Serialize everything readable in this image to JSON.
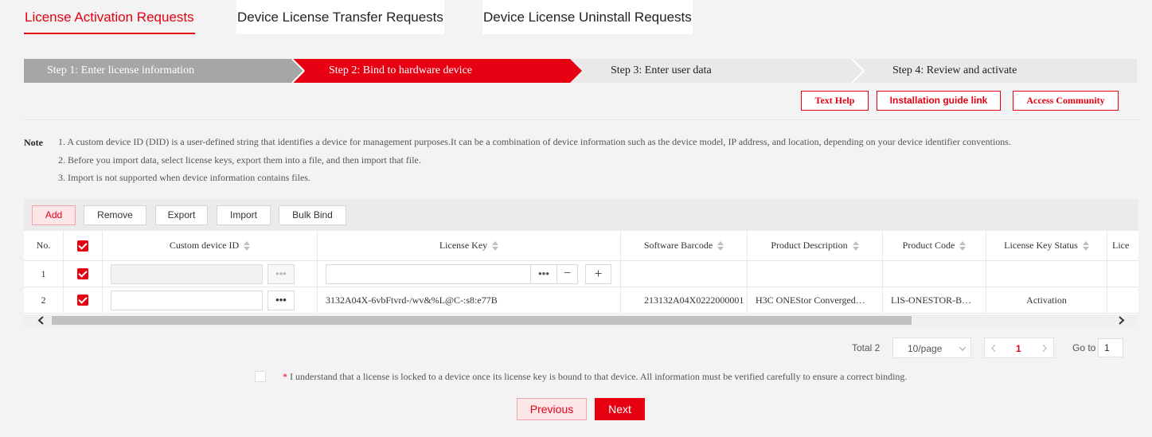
{
  "tabs": [
    {
      "label": "License Activation Requests",
      "active": true
    },
    {
      "label": "Device License Transfer Requests",
      "active": false
    },
    {
      "label": "Device License Uninstall Requests",
      "active": false
    }
  ],
  "steps": [
    {
      "label": "Step 1: Enter license information",
      "state": "done"
    },
    {
      "label": "Step 2: Bind to hardware device",
      "state": "current"
    },
    {
      "label": "Step 3: Enter user data",
      "state": "todo"
    },
    {
      "label": "Step 4: Review and activate",
      "state": "todo"
    }
  ],
  "help": {
    "text_help": "Text Help",
    "install_guide": "Installation guide link",
    "community": "Access Community"
  },
  "note": {
    "title": "Note",
    "lines": [
      "1. A custom device ID (DID) is a user-defined string that identifies a device for management purposes.It can be a combination of device information such as the device model, IP address, and location, depending on your device identifier conventions.",
      "2. Before you import data, select license keys, export them into a file, and then import that file.",
      "3. Import is not supported when device information contains files."
    ]
  },
  "toolbar": {
    "add": "Add",
    "remove": "Remove",
    "export": "Export",
    "import": "Import",
    "bulk_bind": "Bulk Bind"
  },
  "table": {
    "headers": {
      "no": "No.",
      "device_id": "Custom device ID",
      "license_key": "License Key",
      "software_barcode": "Software Barcode",
      "product_description": "Product Description",
      "product_code": "Product Code",
      "license_key_status": "License Key Status",
      "truncated": "Lice"
    },
    "rows": [
      {
        "no": "1",
        "device_id": "",
        "license_key": "",
        "software_barcode": "",
        "product_description": "",
        "product_code": "",
        "status": ""
      },
      {
        "no": "2",
        "device_id": "",
        "license_key": "3132A04X-6vbFtvrd-/wv&%L@C-:s8:e77B",
        "software_barcode": "213132A04X0222000001",
        "product_description": "H3C ONEStor Converged…",
        "product_code": "LIS-ONESTOR-B…",
        "status": "Activation"
      }
    ],
    "more_glyph": "•••",
    "minus_glyph": "−",
    "plus_glyph": "+"
  },
  "pagination": {
    "total": "Total 2",
    "page_size": "10/page",
    "current_page": "1",
    "goto_label": "Go to",
    "goto_value": "1"
  },
  "agreement": {
    "asterisk": "*",
    "text": " I understand that a license is locked to a device once its license key is bound to that device. All information must be verified carefully to ensure a correct binding."
  },
  "nav": {
    "previous": "Previous",
    "next": "Next"
  },
  "colors": {
    "accent": "#e60012",
    "step_done": "#a6a6a6",
    "step_todo": "#e9e9e9"
  }
}
